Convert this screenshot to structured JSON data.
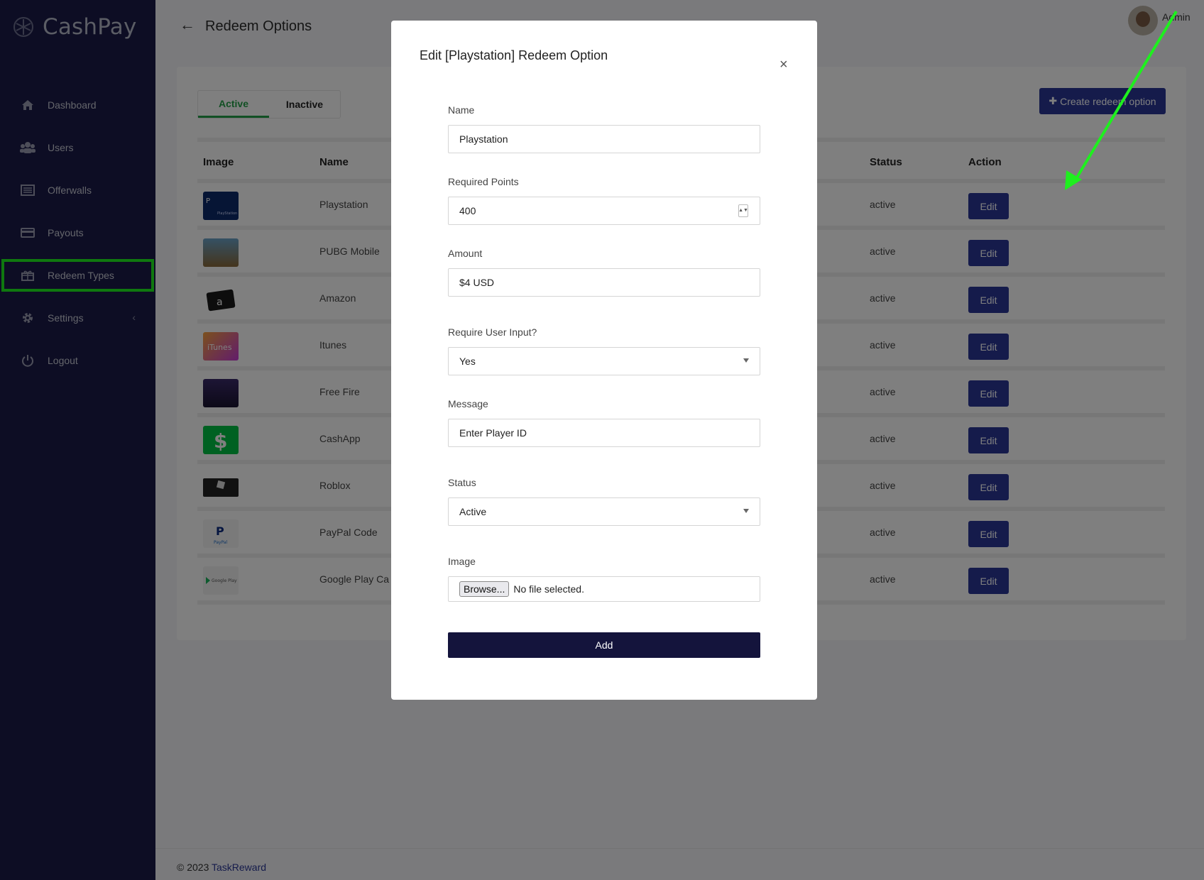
{
  "app": {
    "name": "CashPay"
  },
  "sidebar": {
    "items": [
      {
        "label": "Dashboard",
        "icon": "home-icon"
      },
      {
        "label": "Users",
        "icon": "users-icon"
      },
      {
        "label": "Offerwalls",
        "icon": "list-icon"
      },
      {
        "label": "Payouts",
        "icon": "card-icon"
      },
      {
        "label": "Redeem Types",
        "icon": "gift-icon",
        "selected": true
      },
      {
        "label": "Settings",
        "icon": "gear-icon",
        "chevron": "‹"
      },
      {
        "label": "Logout",
        "icon": "power-icon"
      }
    ]
  },
  "header": {
    "title": "Redeem Options",
    "user": "Admin"
  },
  "tabs": {
    "active": "Active",
    "inactive": "Inactive"
  },
  "create_button": "Create redeem option",
  "table": {
    "headers": {
      "image": "Image",
      "name": "Name",
      "status": "Status",
      "action": "Action"
    },
    "rows": [
      {
        "name": "Playstation",
        "status": "active",
        "action": "Edit"
      },
      {
        "name": "PUBG Mobile",
        "status": "active",
        "action": "Edit"
      },
      {
        "name": "Amazon",
        "status": "active",
        "action": "Edit"
      },
      {
        "name": "Itunes",
        "status": "active",
        "action": "Edit"
      },
      {
        "name": "Free Fire",
        "status": "active",
        "action": "Edit"
      },
      {
        "name": "CashApp",
        "status": "active",
        "action": "Edit"
      },
      {
        "name": "Roblox",
        "status": "active",
        "action": "Edit"
      },
      {
        "name": "PayPal Code",
        "status": "active",
        "action": "Edit"
      },
      {
        "name": "Google Play Ca",
        "status": "active",
        "action": "Edit"
      }
    ]
  },
  "footer": {
    "copyright": "© 2023 ",
    "link": "TaskReward"
  },
  "modal": {
    "title": "Edit [Playstation] Redeem Option",
    "close": "×",
    "fields": {
      "name": {
        "label": "Name",
        "value": "Playstation"
      },
      "points": {
        "label": "Required Points",
        "value": "400"
      },
      "amount": {
        "label": "Amount",
        "value": "$4 USD"
      },
      "require_input": {
        "label": "Require User Input?",
        "value": "Yes"
      },
      "message": {
        "label": "Message",
        "value": "Enter Player ID"
      },
      "status": {
        "label": "Status",
        "value": "Active"
      },
      "image": {
        "label": "Image",
        "button": "Browse...",
        "file_text": "No file selected."
      }
    },
    "submit": "Add"
  },
  "colors": {
    "sidebar": "#1a1b48",
    "primary": "#2a3797",
    "highlight": "#1ef01e",
    "submit": "#14143c"
  }
}
